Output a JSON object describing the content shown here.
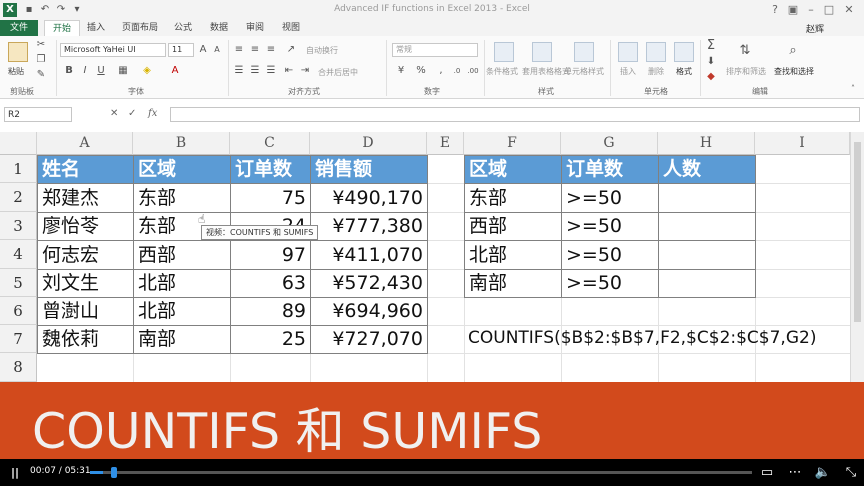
{
  "window": {
    "title": "Advanced IF functions in Excel 2013 - Excel",
    "app_icon": "X",
    "user": "赵辉",
    "help": "?"
  },
  "tabs": [
    "文件",
    "开始",
    "插入",
    "页面布局",
    "公式",
    "数据",
    "审阅",
    "视图"
  ],
  "ribbon": {
    "paste_label": "粘贴",
    "font_name": "Microsoft YaHei UI",
    "font_size": "11",
    "wrap_text": "自动换行",
    "merge_center": "合并后居中",
    "number_format": "常规",
    "cond_format": "条件格式",
    "table_format": "套用表格格式",
    "cell_styles": "单元格样式",
    "insert": "插入",
    "delete": "删除",
    "format": "格式",
    "sort_filter": "排序和筛选",
    "find_select": "查找和选择",
    "groups": {
      "clipboard": "剪贴板",
      "font": "字体",
      "alignment": "对齐方式",
      "number": "数字",
      "styles": "样式",
      "cells": "单元格",
      "editing": "编辑"
    },
    "icons": [
      "paste-icon",
      "cut-icon",
      "copy-icon",
      "format-painter-icon",
      "bold-icon",
      "italic-icon",
      "underline-icon",
      "fill-color-icon",
      "font-color-icon",
      "autosum-icon",
      "sort-icon",
      "find-icon"
    ]
  },
  "formula_bar": {
    "name_box": "R2",
    "fx": "fx",
    "cancel": "✕",
    "enter": "✓",
    "content": ""
  },
  "sheet": {
    "columns": [
      "A",
      "B",
      "C",
      "D",
      "E",
      "F",
      "G",
      "H",
      "I"
    ],
    "rows": [
      "1",
      "2",
      "3",
      "4",
      "5",
      "6",
      "7",
      "8"
    ],
    "table1": {
      "headers": [
        "姓名",
        "区域",
        "订单数",
        "销售额"
      ],
      "rows": [
        [
          "郑建杰",
          "东部",
          "75",
          "¥490,170"
        ],
        [
          "廖怡苓",
          "东部",
          "24",
          "¥777,380"
        ],
        [
          "何志宏",
          "西部",
          "97",
          "¥411,070"
        ],
        [
          "刘文生",
          "北部",
          "63",
          "¥572,430"
        ],
        [
          "曾澍山",
          "北部",
          "89",
          "¥694,960"
        ],
        [
          "魏依莉",
          "南部",
          "25",
          "¥727,070"
        ]
      ]
    },
    "table2": {
      "headers": [
        "区域",
        "订单数",
        "人数"
      ],
      "rows": [
        [
          "东部",
          ">=50",
          ""
        ],
        [
          "西部",
          ">=50",
          ""
        ],
        [
          "北部",
          ">=50",
          ""
        ],
        [
          "南部",
          ">=50",
          ""
        ]
      ]
    },
    "formula_text": "COUNTIFS($B$2:$B$7,F2,$C$2:$C$7,G2)",
    "tooltip": "视频：COUNTIFS 和 SUMIFS"
  },
  "banner": {
    "text": "COUNTIFS 和 SUMIFS",
    "color": "#d24a1c"
  },
  "player": {
    "time": "00:07 / 05:31",
    "progress": 0.02,
    "play_icon": "pause-icon",
    "captions_icon": "captions-icon",
    "more_icon": "more-icon",
    "volume_icon": "volume-icon",
    "fullscreen_icon": "exit-fullscreen-icon"
  }
}
